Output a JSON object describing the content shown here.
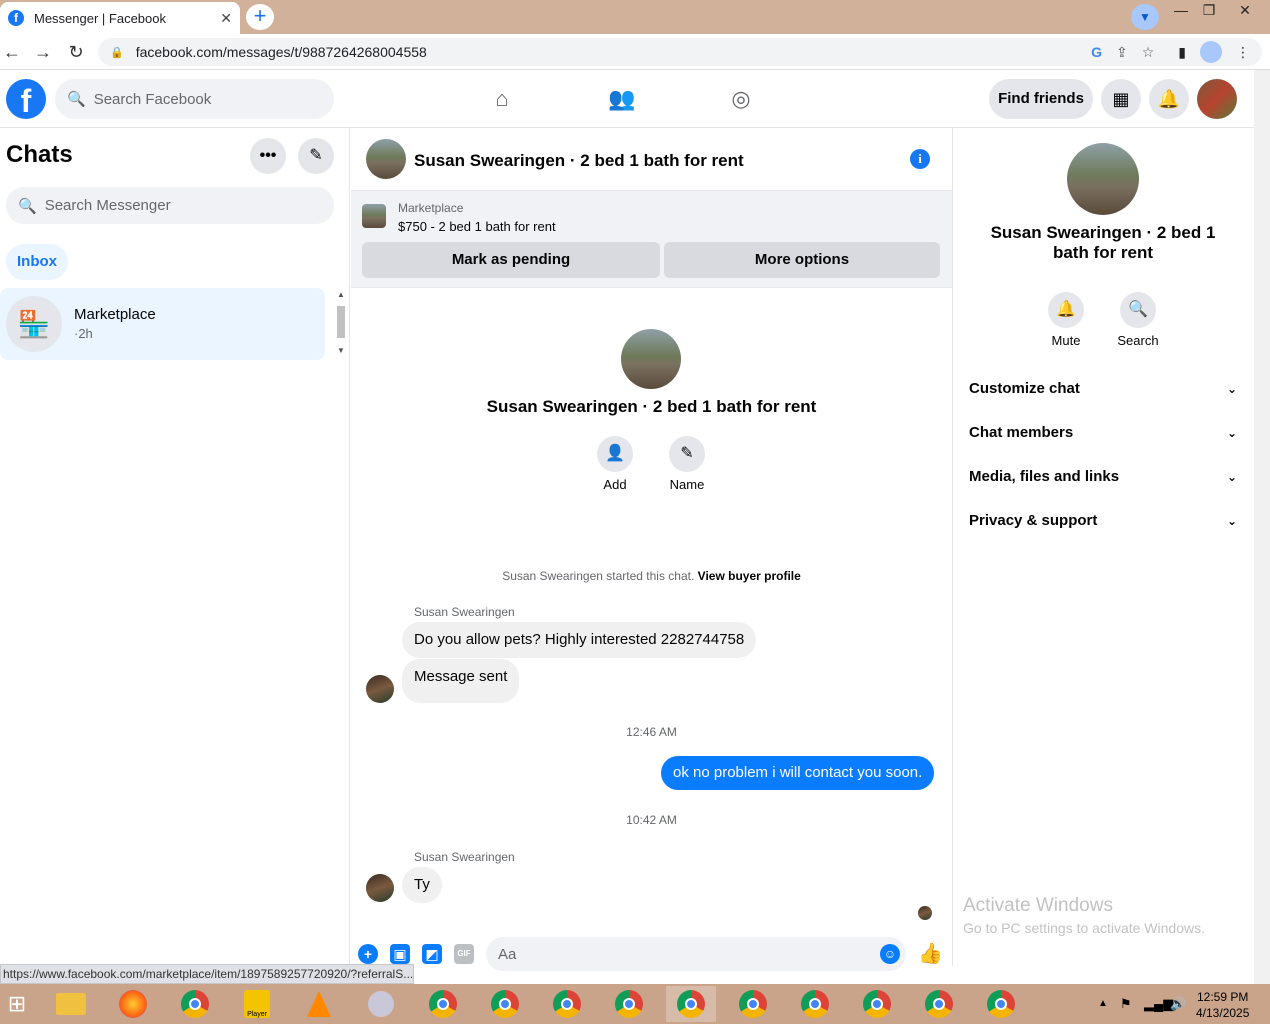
{
  "browser": {
    "tab_title": "Messenger | Facebook",
    "tab_close": "✕",
    "new_tab": "+",
    "url": "facebook.com/messages/t/9887264268004558",
    "status_url": "https://www.facebook.com/marketplace/item/1897589257720920/?referralS..."
  },
  "fb": {
    "logo": "f",
    "search_placeholder": "Search Facebook",
    "find_friends": "Find friends"
  },
  "left": {
    "title": "Chats",
    "more": "•••",
    "compose": "✎",
    "search_placeholder": "Search Messenger",
    "inbox": "Inbox",
    "conversation": {
      "name": "Marketplace",
      "time": "·2h"
    }
  },
  "chat": {
    "header_title": "Susan Swearingen · 2 bed 1 bath for rent",
    "info": "i",
    "marketplace_label": "Marketplace",
    "listing": "$750 - 2 bed 1 bath for rent",
    "mark_pending": "Mark as pending",
    "more_options": "More options",
    "profile_name": "Susan Swearingen · 2 bed 1 bath for rent",
    "add_label": "Add",
    "name_label": "Name",
    "started_text": "Susan Swearingen started this chat.",
    "view_buyer": "View buyer profile",
    "sender1": "Susan Swearingen",
    "msg1": "Do you allow pets? Highly interested 2282744758",
    "msg2": "Message sent",
    "time1": "12:46 AM",
    "my_msg": "ok no problem  i will contact you soon.",
    "time2": "10:42 AM",
    "sender2": "Susan Swearingen",
    "msg3": "Ty",
    "composer_placeholder": "Aa"
  },
  "right": {
    "name": "Susan Swearingen · 2 bed 1 bath for rent",
    "mute": "Mute",
    "search": "Search",
    "items": [
      {
        "label": "Customize chat"
      },
      {
        "label": "Chat members"
      },
      {
        "label": "Media, files and links"
      },
      {
        "label": "Privacy & support"
      }
    ],
    "activate_title": "Activate Windows",
    "activate_sub": "Go to PC settings to activate Windows."
  },
  "taskbar": {
    "time": "12:59 PM",
    "date": "4/13/2025"
  },
  "colors": {
    "accent": "#1877f2",
    "bubble_mine": "#0a7cff",
    "taskbar": "#c9a48b"
  }
}
